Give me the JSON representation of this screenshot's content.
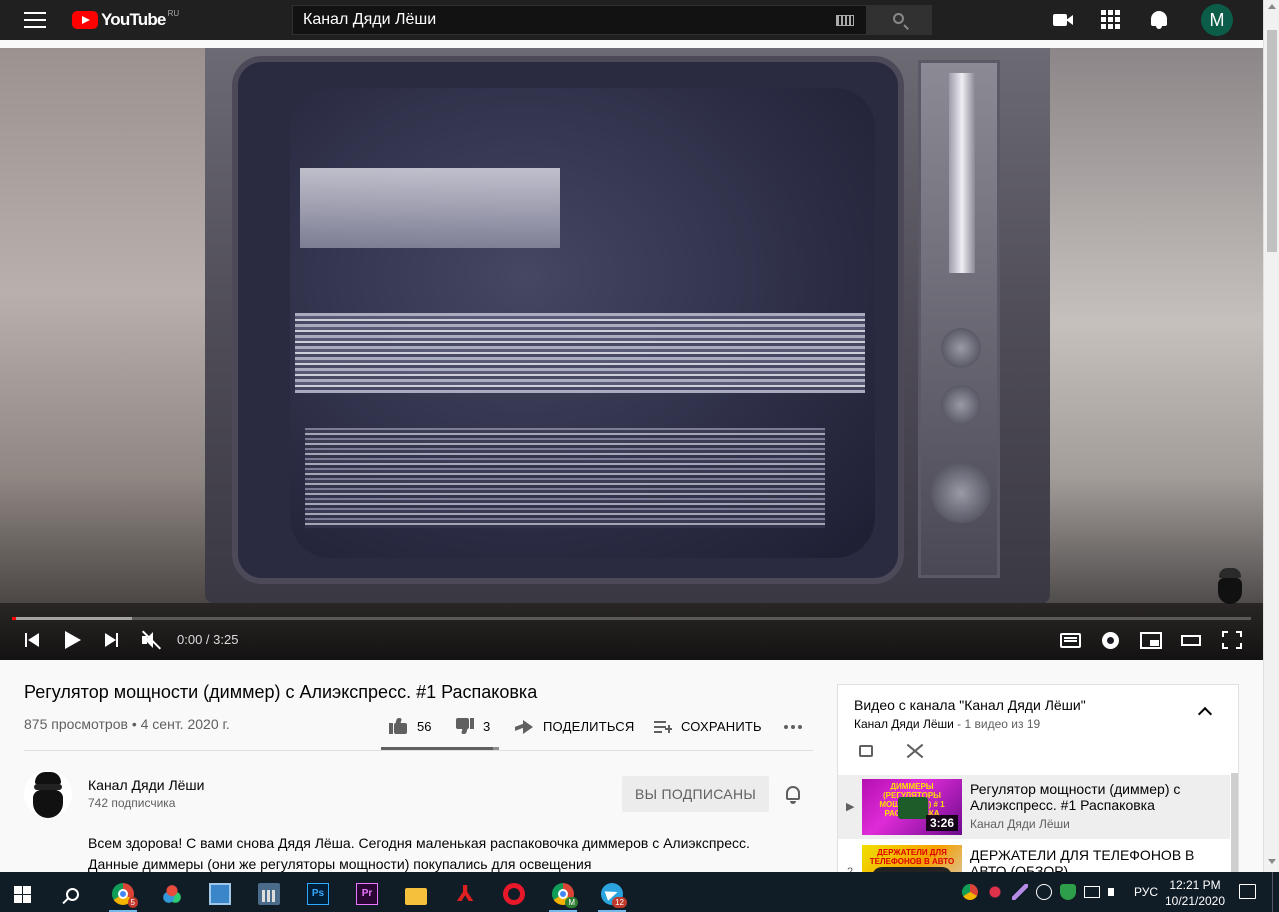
{
  "header": {
    "logo_text": "YouTube",
    "logo_region": "RU",
    "search_value": "Канал Дяди Лёши",
    "avatar_letter": "M"
  },
  "player": {
    "time_current": "0:00",
    "time_total": "3:25",
    "time_display": "0:00 / 3:25",
    "progress_played": 0.003,
    "progress_buffered": 0.097
  },
  "video": {
    "title": "Регулятор мощности (диммер) с Алиэкспресс. #1 Распаковка",
    "views": "875 просмотров",
    "separator": "•",
    "date": "4 сент. 2020 г.",
    "likes": "56",
    "dislikes": "3",
    "share_label": "ПОДЕЛИТЬСЯ",
    "save_label": "СОХРАНИТЬ",
    "like_ratio": 0.95
  },
  "channel": {
    "name": "Канал Дяди Лёши",
    "subscribers": "742 подписчика",
    "subscribe_label": "ВЫ ПОДПИСАНЫ"
  },
  "description": {
    "text": "Всем здорова! С вами снова Дядя Лёша. Сегодня маленькая распаковочка диммеров с Алиэкспресс. Данные диммеры (они же регуляторы мощности) покупались для освещения"
  },
  "playlist": {
    "title": "Видео с канала \"Канал Дяди Лёши\"",
    "owner": "Канал Дяди Лёши",
    "separator": " - ",
    "count": "1 видео из 19",
    "items": [
      {
        "index": "▶",
        "title": "Регулятор мощности (диммер) с Алиэкспресс. #1 Распаковка",
        "channel": "Канал Дяди Лёши",
        "duration": "3:26",
        "thumb_text": "ДИММЕРЫ (РЕГУЛЯТОРЫ МОЩНОСТИ) # 1 РАСПАКОВКА"
      },
      {
        "index": "2",
        "title": "ДЕРЖАТЕЛИ ДЛЯ ТЕЛЕФОНОВ В АВТО (ОБЗОР)",
        "channel": "",
        "duration": "",
        "thumb_text": "ДЕРЖАТЕЛИ ДЛЯ ТЕЛЕФОНОВ В АВТО"
      }
    ]
  },
  "taskbar": {
    "chrome_badge": "5",
    "chrome2_badge": "M",
    "telegram_badge": "12",
    "language": "РУС",
    "time": "12:21 PM",
    "date": "10/21/2020"
  },
  "icons": {
    "accent_red": "#ff0000",
    "topbar_bg": "#202020",
    "taskbar_bg": "#111d26"
  }
}
